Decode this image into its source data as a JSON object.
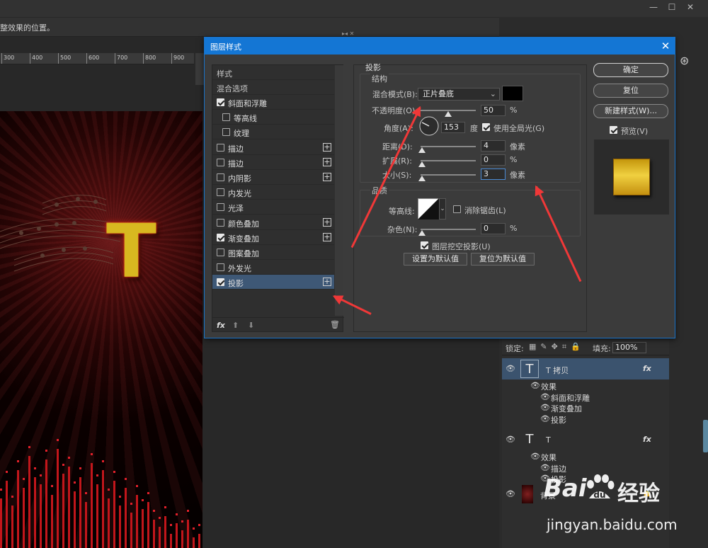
{
  "app": {
    "options_hint": "整效果的位置。",
    "ruler_ticks": [
      "300",
      "400",
      "500",
      "600",
      "700",
      "800",
      "900"
    ]
  },
  "dialog": {
    "title": "图层样式",
    "styles_header": "样式",
    "blend_options": "混合选项",
    "items": [
      {
        "label": "斜面和浮雕",
        "checked": true,
        "plus": false,
        "indent": false
      },
      {
        "label": "等高线",
        "checked": false,
        "plus": false,
        "indent": true
      },
      {
        "label": "纹理",
        "checked": false,
        "plus": false,
        "indent": true
      },
      {
        "label": "描边",
        "checked": false,
        "plus": true,
        "indent": false
      },
      {
        "label": "描边",
        "checked": false,
        "plus": true,
        "indent": false
      },
      {
        "label": "内阴影",
        "checked": false,
        "plus": true,
        "indent": false
      },
      {
        "label": "内发光",
        "checked": false,
        "plus": false,
        "indent": false
      },
      {
        "label": "光泽",
        "checked": false,
        "plus": false,
        "indent": false
      },
      {
        "label": "颜色叠加",
        "checked": false,
        "plus": true,
        "indent": false
      },
      {
        "label": "渐变叠加",
        "checked": true,
        "plus": true,
        "indent": false
      },
      {
        "label": "图案叠加",
        "checked": false,
        "plus": false,
        "indent": false
      },
      {
        "label": "外发光",
        "checked": false,
        "plus": false,
        "indent": false
      },
      {
        "label": "投影",
        "checked": true,
        "plus": true,
        "indent": false,
        "selected": true
      }
    ],
    "fx_label": "fx",
    "section_title": "投影",
    "structure_title": "结构",
    "blend_mode_label": "混合模式(B):",
    "blend_mode_value": "正片叠底",
    "opacity_label": "不透明度(O):",
    "opacity_value": "50",
    "opacity_unit": "%",
    "opacity_level": 0.5,
    "angle_label": "角度(A):",
    "angle_value": "153",
    "angle_unit": "度",
    "global_light_label": "使用全局光(G)",
    "distance_label": "距离(D):",
    "distance_value": "4",
    "spread_label": "扩展(R):",
    "spread_value": "0",
    "size_label": "大小(S):",
    "size_value": "3",
    "px_unit": "像素",
    "quality_title": "品质",
    "contour_label": "等高线:",
    "antialias_label": "消除锯齿(L)",
    "noise_label": "杂色(N):",
    "noise_value": "0",
    "knockout_label": "图层挖空投影(U)",
    "set_default": "设置为默认值",
    "reset_default": "复位为默认值",
    "ok": "确定",
    "reset": "复位",
    "new_style": "新建样式(W)...",
    "preview": "预览(V)",
    "shadow_color": "#000000"
  },
  "layers": {
    "lock_label": "锁定:",
    "fill_label": "填充:",
    "fill_value": "100%",
    "rows": [
      {
        "type": "layer",
        "name": "T 拷贝",
        "fx": "fx",
        "selected": true
      },
      {
        "type": "effects",
        "name": "效果"
      },
      {
        "type": "effect",
        "name": "斜面和浮雕"
      },
      {
        "type": "effect",
        "name": "渐变叠加"
      },
      {
        "type": "effect",
        "name": "投影"
      },
      {
        "type": "layer",
        "name": "T",
        "fx": "fx",
        "selected": false
      },
      {
        "type": "effects",
        "name": "效果"
      },
      {
        "type": "effect",
        "name": "描边"
      },
      {
        "type": "effect",
        "name": "投影"
      },
      {
        "type": "background",
        "name": "背景"
      }
    ]
  },
  "watermark": {
    "brand_a": "Bai",
    "brand_b": "经验",
    "url": "jingyan.baidu.com"
  },
  "colors": {
    "title_bar": "#1476d4",
    "selection": "#3e5876",
    "annotation_arrow": "#f03838"
  }
}
